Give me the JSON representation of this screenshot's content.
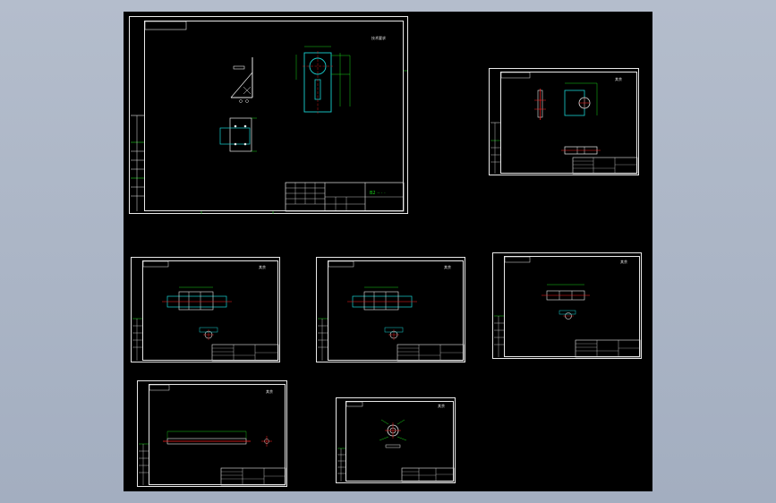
{
  "viewport": {
    "background": "#a9b4c5",
    "canvas_background": "#000000"
  },
  "colors": {
    "frame": "#e8e8e8",
    "geometry": "#19d2d2",
    "dimension": "#19d219",
    "centerline": "#ff2020",
    "text": "#e8e8e8"
  },
  "sheets": [
    {
      "id": "assembly",
      "title_mark": "技术要求",
      "stamp": ""
    },
    {
      "id": "part-2",
      "title_mark": "其余",
      "stamp": ""
    },
    {
      "id": "part-3",
      "title_mark": "其余",
      "stamp": ""
    },
    {
      "id": "part-4",
      "title_mark": "其余",
      "stamp": ""
    },
    {
      "id": "part-5",
      "title_mark": "其余",
      "stamp": ""
    },
    {
      "id": "part-6",
      "title_mark": "其余",
      "stamp": ""
    },
    {
      "id": "part-7",
      "title_mark": "其余",
      "stamp": ""
    }
  ]
}
